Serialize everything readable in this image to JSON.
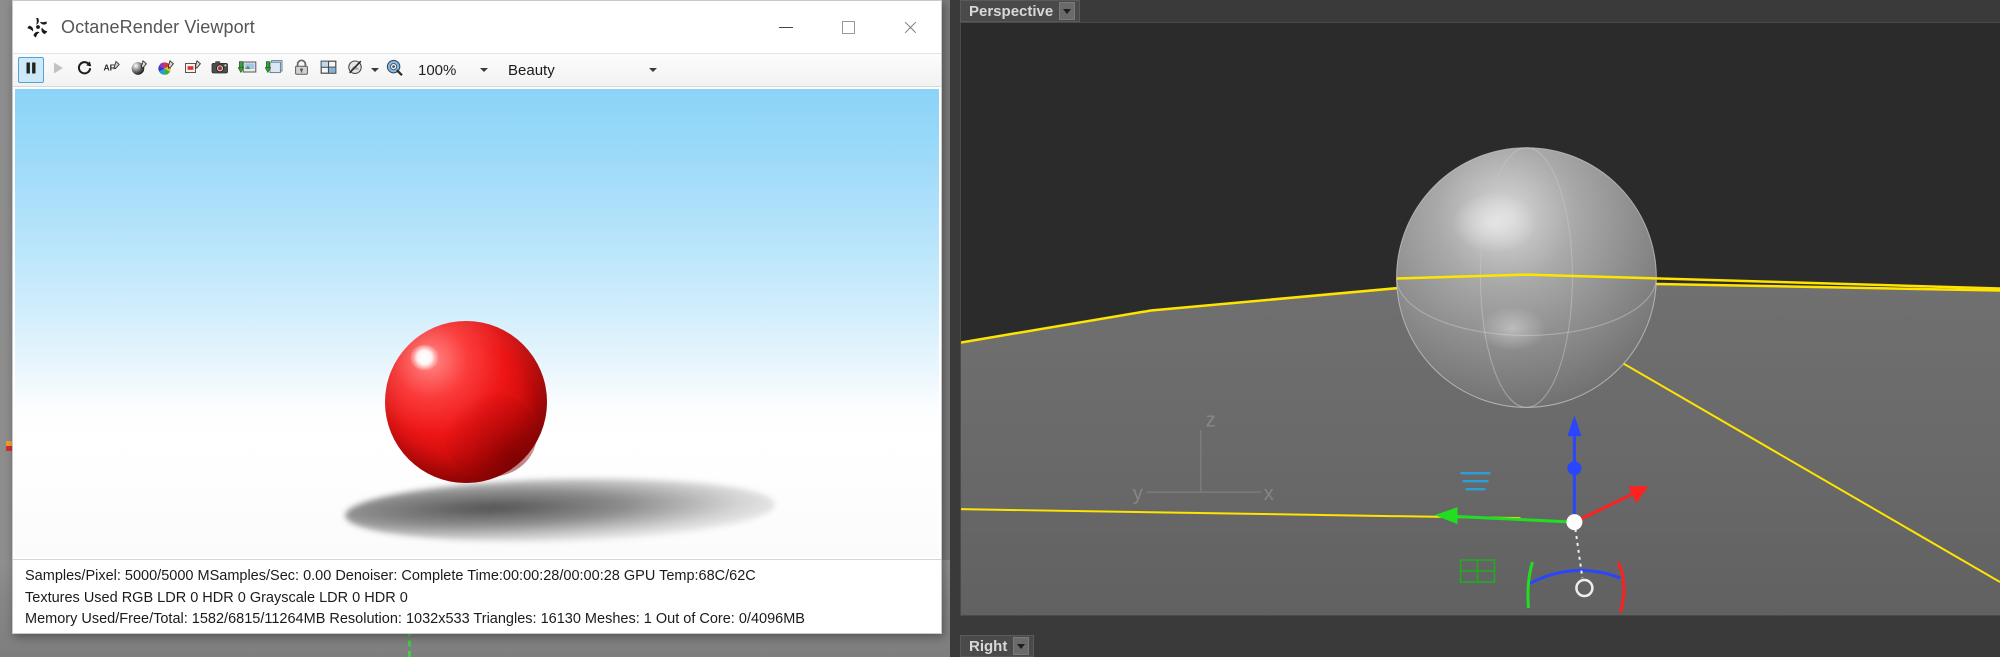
{
  "window": {
    "title": "OctaneRender Viewport",
    "app_icon": "octane-logo-icon",
    "controls": {
      "minimize": "minimize-icon",
      "maximize": "maximize-icon",
      "close": "close-icon"
    }
  },
  "toolbar": {
    "buttons": [
      {
        "name": "pause-render-button",
        "icon": "pause-icon",
        "selected": true,
        "disabled": false
      },
      {
        "name": "start-render-button",
        "icon": "play-icon",
        "selected": false,
        "disabled": true
      },
      {
        "name": "restart-render-button",
        "icon": "restart-arrow-icon",
        "selected": false,
        "disabled": false
      },
      {
        "name": "autofocus-picker-button",
        "icon": "autofocus-pick-icon",
        "selected": false,
        "disabled": false
      },
      {
        "name": "material-picker-button",
        "icon": "material-pick-icon",
        "selected": false,
        "disabled": false
      },
      {
        "name": "white-balance-picker-button",
        "icon": "color-pick-icon",
        "selected": false,
        "disabled": false
      },
      {
        "name": "object-picker-button",
        "icon": "object-pick-icon",
        "selected": false,
        "disabled": false
      },
      {
        "name": "render-camera-button",
        "icon": "camera-icon",
        "selected": false,
        "disabled": false
      },
      {
        "name": "save-image-button",
        "icon": "save-image-icon",
        "selected": false,
        "disabled": false
      },
      {
        "name": "save-layered-image-button",
        "icon": "save-layers-icon",
        "selected": false,
        "disabled": false
      },
      {
        "name": "lock-resolution-button",
        "icon": "lock-icon",
        "selected": false,
        "disabled": false
      },
      {
        "name": "render-region-button",
        "icon": "region-grid-icon",
        "selected": false,
        "disabled": false
      },
      {
        "name": "denoiser-toggle-button",
        "icon": "denoise-off-icon",
        "selected": false,
        "disabled": false
      }
    ],
    "denoiser_caret": "chevron-down-icon",
    "focus-picker": {
      "name": "focus-picker-button",
      "icon": "focus-pick-icon"
    },
    "zoom_level": "100%",
    "zoom_caret": "chevron-down-icon",
    "render_pass": "Beauty",
    "render_pass_caret": "chevron-down-icon"
  },
  "render": {
    "description": "Rendered glossy red sphere on white ground with blue sky gradient",
    "sphere_color": "#ee1616",
    "sky_top_color": "#8ad3f8",
    "ground_color": "#ffffff"
  },
  "status": {
    "line1": "Samples/Pixel: 5000/5000  MSamples/Sec: 0.00  Denoiser: Complete  Time:00:00:28/00:00:28  GPU Temp:68C/62C",
    "line2": "Textures Used RGB LDR 0  HDR 0  Grayscale LDR 0  HDR 0",
    "line3": "Memory Used/Free/Total: 1582/6815/11264MB  Resolution: 1032x533  Triangles: 16130  Meshes: 1 Out of Core: 0/4096MB"
  },
  "viewport3d": {
    "top_label": "Perspective",
    "bottom_label": "Right",
    "top_caret": "chevron-down-icon",
    "bottom_caret": "chevron-down-icon",
    "selection_color": "#ffe400",
    "background_color": "#2b2b2b",
    "ground_color": "#6a6a6a",
    "axis_labels": {
      "x": "x",
      "y": "y",
      "z": "z"
    },
    "gizmo": {
      "name": "transform-gizmo",
      "axis_x_color": "#ff2020",
      "axis_y_color": "#20e020",
      "axis_z_color": "#2040ff"
    }
  }
}
